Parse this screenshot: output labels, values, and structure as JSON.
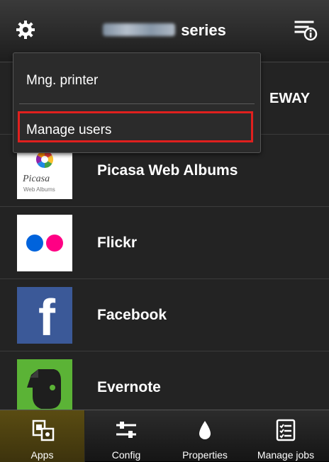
{
  "header": {
    "title_suffix": "series"
  },
  "menu": {
    "items": [
      {
        "label": "Mng. printer"
      },
      {
        "label": "Manage users",
        "highlighted": true
      }
    ]
  },
  "partial_text": "EWAY",
  "apps": [
    {
      "label": "Picasa Web Albums",
      "icon": "picasa-icon",
      "icon_text": "Picasa",
      "icon_subtext": "Web Albums"
    },
    {
      "label": "Flickr",
      "icon": "flickr-icon"
    },
    {
      "label": "Facebook",
      "icon": "facebook-icon",
      "icon_text": "f"
    },
    {
      "label": "Evernote",
      "icon": "evernote-icon"
    }
  ],
  "tabs": [
    {
      "label": "Apps",
      "icon": "apps-icon",
      "active": true
    },
    {
      "label": "Config",
      "icon": "config-icon"
    },
    {
      "label": "Properties",
      "icon": "ink-drop-icon"
    },
    {
      "label": "Manage jobs",
      "icon": "manage-jobs-icon"
    }
  ],
  "colors": {
    "highlight": "#e0201e",
    "flickr_blue": "#0063dc",
    "flickr_pink": "#ff0084",
    "facebook": "#3b5998",
    "evernote": "#5bb336",
    "active_tab": "#5a4c12"
  }
}
